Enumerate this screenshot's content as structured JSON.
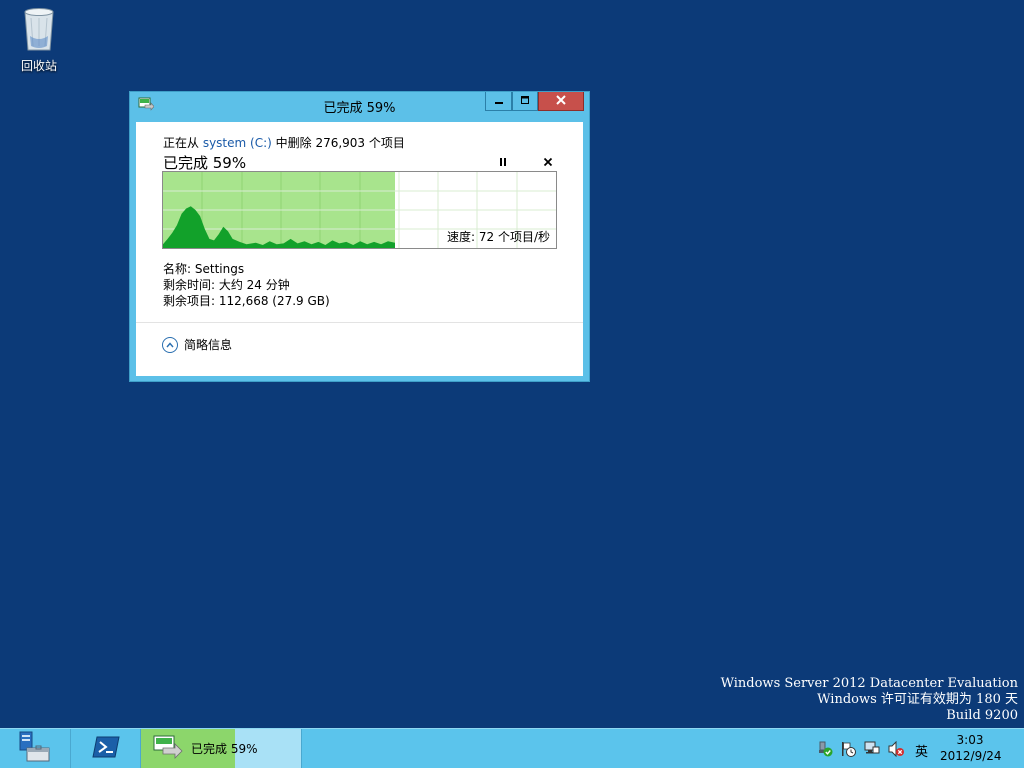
{
  "desktop": {
    "recycle_bin_label": "回收站",
    "watermark": {
      "line1": "Windows Server 2012 Datacenter Evaluation",
      "line2": "Windows 许可证有效期为 180 天",
      "line3": "Build 9200"
    }
  },
  "dialog": {
    "title": "已完成 59%",
    "status_prefix": "正在从 ",
    "source_link": "system (C:)",
    "status_suffix": " 中删除 276,903 个项目",
    "percent_heading": "已完成 59%",
    "progress_fraction": 0.59,
    "speed": "速度: 72 个项目/秒",
    "name": "名称: Settings",
    "time_remaining": "剩余时间: 大约 24 分钟",
    "items_remaining": "剩余项目: 112,668 (27.9 GB)",
    "fewer_details": "简略信息",
    "icons": {
      "app": "file-delete-icon",
      "minimize": "minimize-icon",
      "maximize": "maximize-icon",
      "close": "close-icon",
      "pause": "pause-icon",
      "cancel": "cancel-icon",
      "collapse": "chevron-up-icon"
    },
    "colors": {
      "graph_done": "#a8e48d",
      "graph_curve": "#12a12a",
      "title_bg": "#5cc0e8",
      "close_bg": "#c7504b"
    }
  },
  "taskbar": {
    "task_label": "已完成 59%",
    "task_progress": 0.59,
    "ime": "英",
    "clock_time": "3:03",
    "clock_date": "2012/9/24",
    "icons": [
      "server-manager-icon",
      "powershell-icon",
      "action-center-icon",
      "flag-icon",
      "network-icon",
      "volume-muted-icon"
    ]
  }
}
